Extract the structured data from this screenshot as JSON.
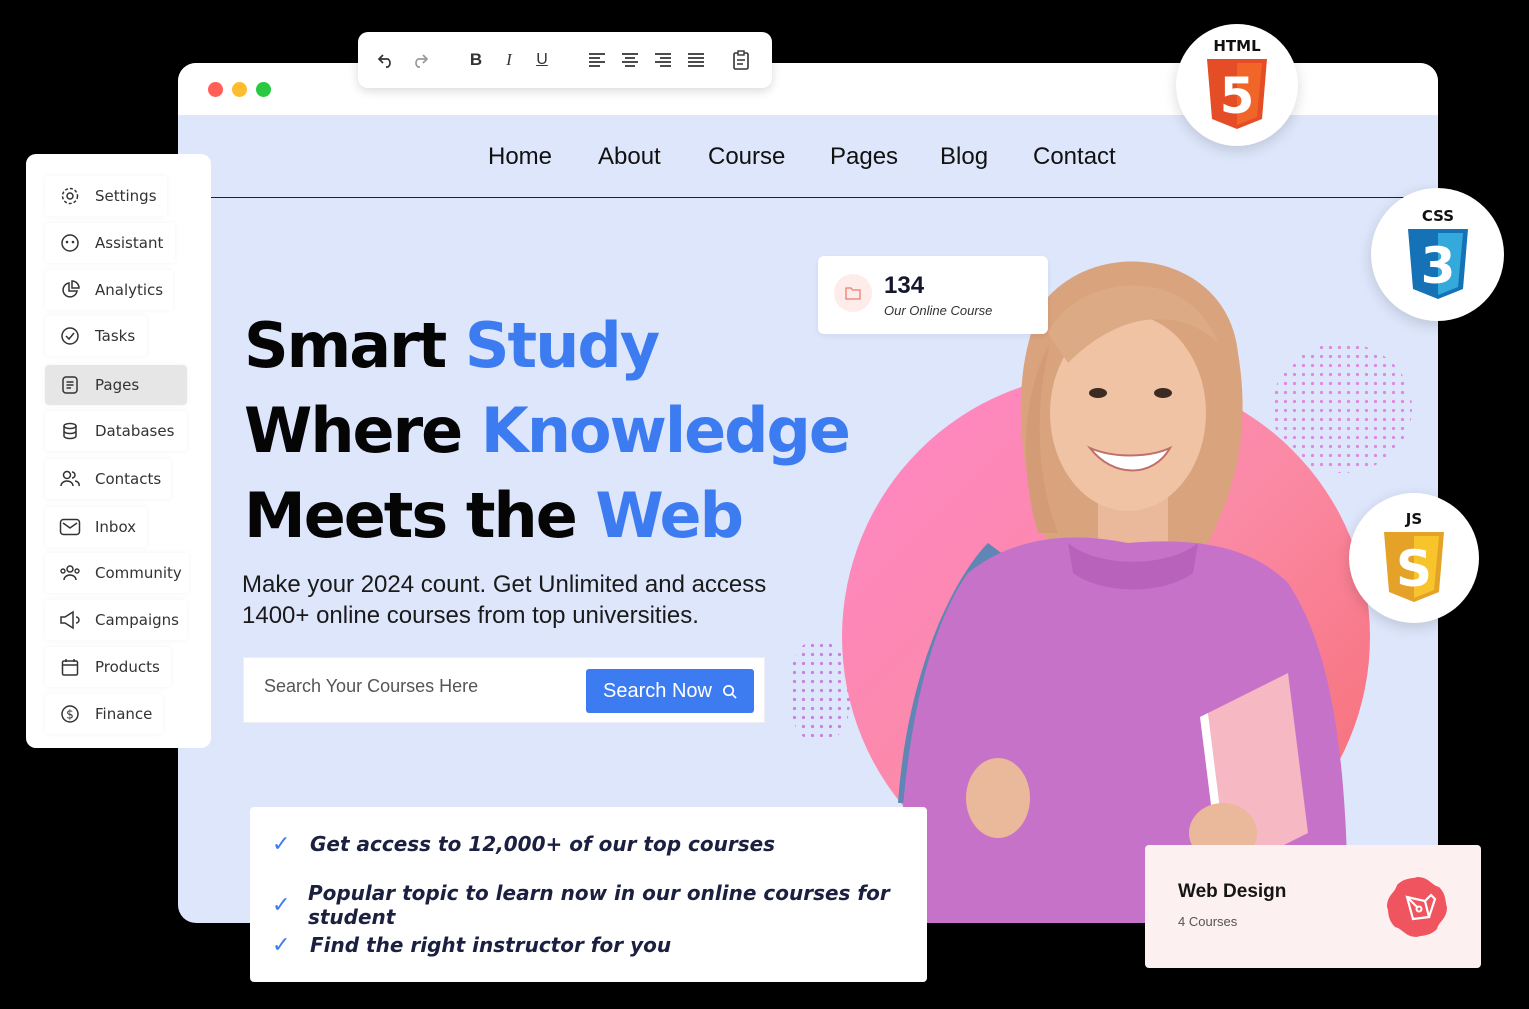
{
  "toolbar": {
    "buttons": [
      "undo-icon",
      "redo-icon",
      "bold-icon",
      "italic-icon",
      "underline-icon",
      "align-left-icon",
      "align-center-icon",
      "align-right-icon",
      "align-justify-icon",
      "paste-icon"
    ]
  },
  "nav": {
    "items": [
      "Home",
      "About",
      "Course",
      "Pages",
      "Blog",
      "Contact"
    ]
  },
  "hero": {
    "line1_a": "Smart ",
    "line1_b": "Study",
    "line2_a": "Where ",
    "line2_b": "Knowledge",
    "line3_a": "Meets the ",
    "line3_b": "Web",
    "subtitle_1": "Make your 2024 count. Get Unlimited and access",
    "subtitle_2": "1400+ online courses from top universities.",
    "accent_color": "#3d7cf0"
  },
  "search": {
    "placeholder": "Search Your Courses Here",
    "button": "Search Now"
  },
  "stat": {
    "value": "134",
    "label": "Our Online Course"
  },
  "sidebar": {
    "items": [
      {
        "label": "Settings",
        "icon": "gear-icon"
      },
      {
        "label": "Assistant",
        "icon": "assistant-icon"
      },
      {
        "label": "Analytics",
        "icon": "pie-chart-icon"
      },
      {
        "label": "Tasks",
        "icon": "check-circle-icon"
      },
      {
        "label": "Pages",
        "icon": "document-icon",
        "active": true
      },
      {
        "label": "Databases",
        "icon": "database-icon"
      },
      {
        "label": "Contacts",
        "icon": "users-icon"
      },
      {
        "label": "Inbox",
        "icon": "mail-icon"
      },
      {
        "label": "Community",
        "icon": "community-icon"
      },
      {
        "label": "Campaigns",
        "icon": "megaphone-icon"
      },
      {
        "label": "Products",
        "icon": "calendar-icon"
      },
      {
        "label": "Finance",
        "icon": "dollar-icon"
      }
    ]
  },
  "badges": {
    "html": "HTML",
    "html_digit": "5",
    "css": "CSS",
    "css_digit": "3",
    "js": "JS",
    "js_digit": "S"
  },
  "checklist": {
    "items": [
      "Get access to 12,000+ of our top courses",
      "Popular topic to learn now in our online courses for student",
      "Find the right instructor for you"
    ]
  },
  "course_card": {
    "title": "Web Design",
    "subtitle": "4 Courses",
    "icon": "pen-tool-icon"
  }
}
